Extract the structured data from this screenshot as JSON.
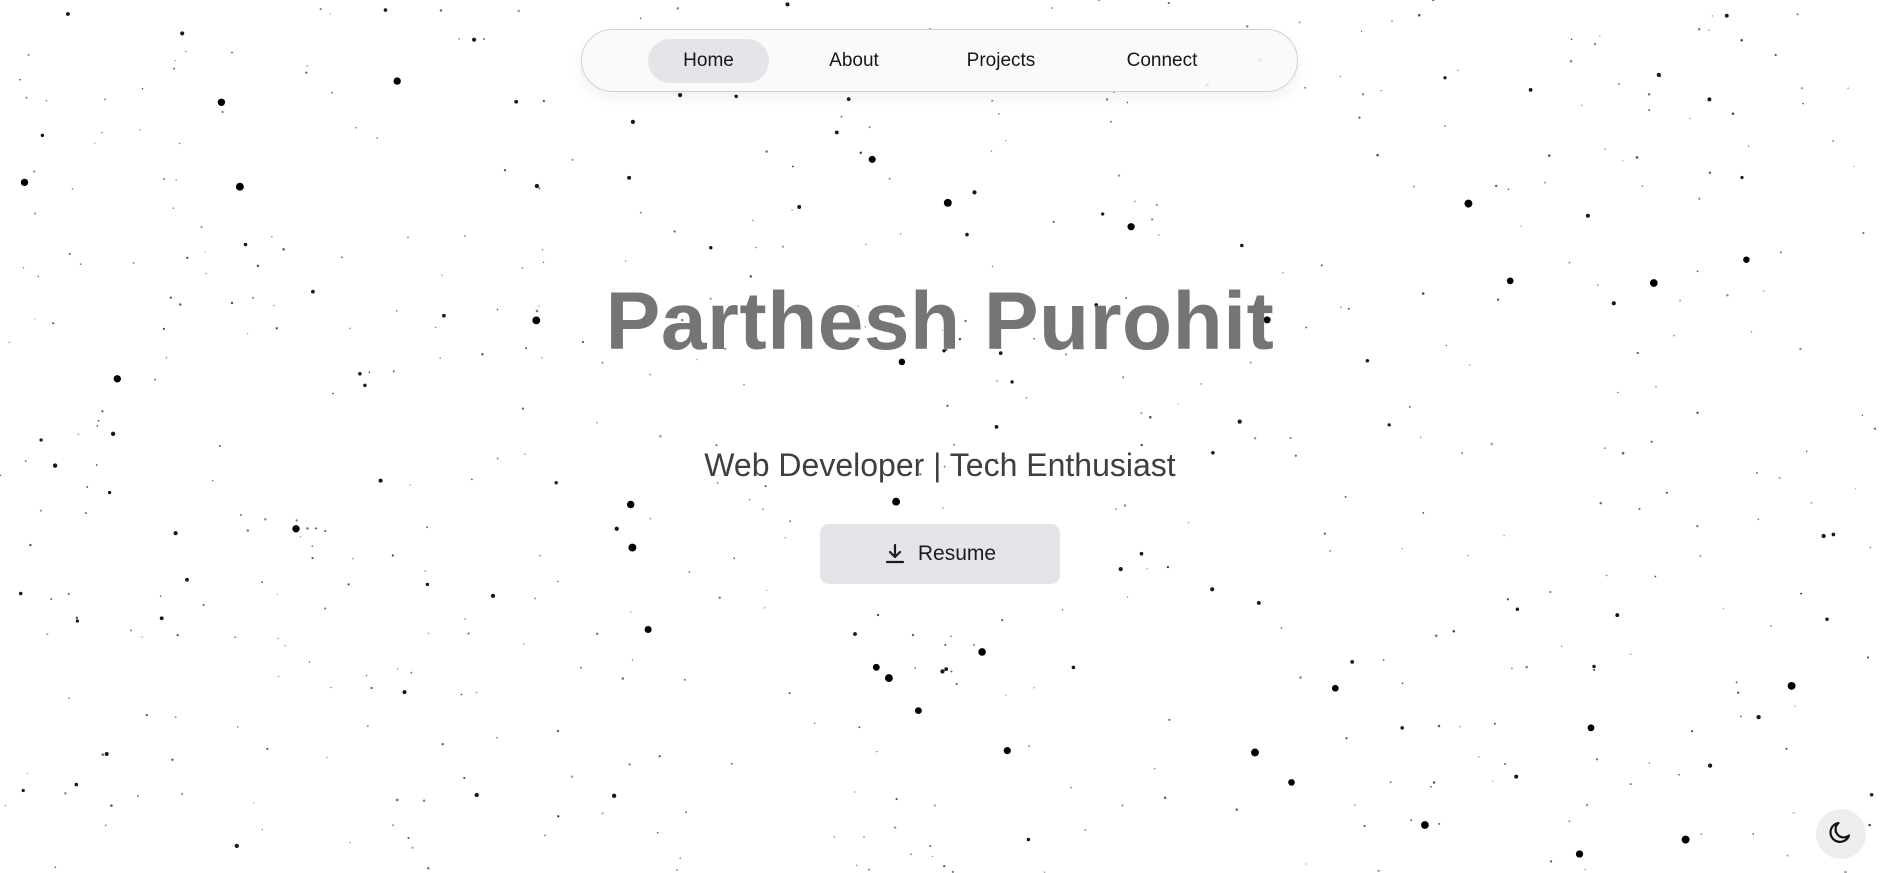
{
  "nav": {
    "items": [
      {
        "label": "Home",
        "active": true
      },
      {
        "label": "About",
        "active": false
      },
      {
        "label": "Projects",
        "active": false
      },
      {
        "label": "Connect",
        "active": false
      }
    ]
  },
  "hero": {
    "name": "Parthesh Purohit",
    "tagline": "Web Developer | Tech Enthusiast"
  },
  "resume_button": {
    "label": "Resume",
    "icon": "download-icon"
  },
  "theme_toggle": {
    "icon": "moon-icon"
  },
  "colors": {
    "background": "#ffffff",
    "stars": "#000000",
    "name_text": "#757575",
    "pill_active": "#e4e5e8"
  }
}
